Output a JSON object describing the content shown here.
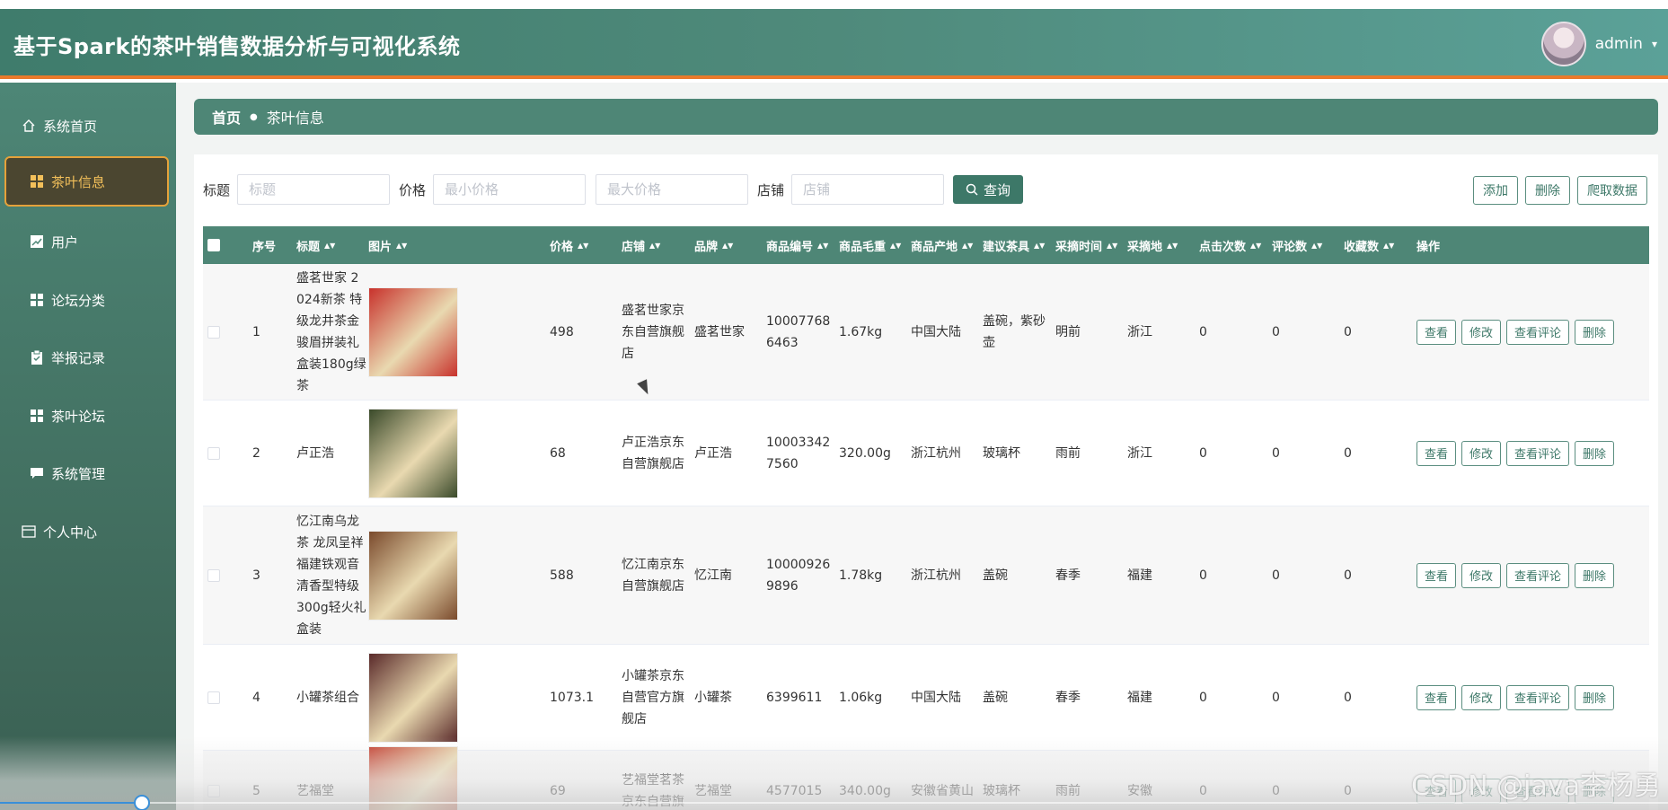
{
  "header": {
    "title": "基于Spark的茶叶销售数据分析与可视化系统",
    "username": "admin",
    "caret": "▾"
  },
  "sidebar": {
    "items": [
      {
        "label": "系统首页",
        "icon": "home-icon"
      },
      {
        "label": "茶叶信息",
        "icon": "grid-icon",
        "active": true
      },
      {
        "label": "用户",
        "icon": "chart-icon"
      },
      {
        "label": "论坛分类",
        "icon": "grid-icon"
      },
      {
        "label": "举报记录",
        "icon": "clipboard-icon"
      },
      {
        "label": "茶叶论坛",
        "icon": "grid-icon"
      },
      {
        "label": "系统管理",
        "icon": "chat-icon"
      },
      {
        "label": "个人中心",
        "icon": "card-icon"
      }
    ]
  },
  "breadcrumb": {
    "home": "首页",
    "current": "茶叶信息"
  },
  "search": {
    "title_label": "标题",
    "title_placeholder": "标题",
    "price_label": "价格",
    "min_price_placeholder": "最小价格",
    "max_price_placeholder": "最大价格",
    "store_label": "店铺",
    "store_placeholder": "店铺",
    "query_button": "查询"
  },
  "toolbar": {
    "add": "添加",
    "delete": "删除",
    "crawl": "爬取数据"
  },
  "table": {
    "headers": {
      "index": "序号",
      "title": "标题",
      "image": "图片",
      "price": "价格",
      "store": "店铺",
      "brand": "品牌",
      "sku": "商品编号",
      "weight": "商品毛重",
      "origin": "商品产地",
      "vessel": "建议茶具",
      "pick_time": "采摘时间",
      "pick_place": "采摘地",
      "clicks": "点击次数",
      "comments": "评论数",
      "favorites": "收藏数",
      "actions": "操作"
    },
    "row_actions": {
      "view": "查看",
      "edit": "修改",
      "view_comments": "查看评论",
      "delete": "删除"
    },
    "rows": [
      {
        "index": "1",
        "title": "盛茗世家 2024新茶 特级龙井茶金骏眉拼装礼盒装180g绿茶",
        "image_color": "#c8322c",
        "price": "498",
        "store": "盛茗世家京东自营旗舰店",
        "brand": "盛茗世家",
        "sku": "100077686463",
        "weight": "1.67kg",
        "origin": "中国大陆",
        "vessel": "盖碗，紫砂壶",
        "pick_time": "明前",
        "pick_place": "浙江",
        "clicks": "0",
        "comments": "0",
        "favorites": "0"
      },
      {
        "index": "2",
        "title": "卢正浩",
        "image_color": "#3a4a2a",
        "price": "68",
        "store": "卢正浩京东自营旗舰店",
        "brand": "卢正浩",
        "sku": "100033427560",
        "weight": "320.00g",
        "origin": "浙江杭州",
        "vessel": "玻璃杯",
        "pick_time": "雨前",
        "pick_place": "浙江",
        "clicks": "0",
        "comments": "0",
        "favorites": "0"
      },
      {
        "index": "3",
        "title": "忆江南乌龙茶 龙凤呈祥福建铁观音清香型特级300g轻火礼盒装",
        "image_color": "#7a4a2c",
        "price": "588",
        "store": "忆江南京东自营旗舰店",
        "brand": "忆江南",
        "sku": "100009269896",
        "weight": "1.78kg",
        "origin": "浙江杭州",
        "vessel": "盖碗",
        "pick_time": "春季",
        "pick_place": "福建",
        "clicks": "0",
        "comments": "0",
        "favorites": "0"
      },
      {
        "index": "4",
        "title": "小罐茶组合",
        "image_color": "#5a2a2a",
        "price": "1073.1",
        "store": "小罐茶京东自营官方旗舰店",
        "brand": "小罐茶",
        "sku": "6399611",
        "weight": "1.06kg",
        "origin": "中国大陆",
        "vessel": "盖碗",
        "pick_time": "春季",
        "pick_place": "福建",
        "clicks": "0",
        "comments": "0",
        "favorites": "0"
      },
      {
        "index": "5",
        "title": "艺福堂",
        "image_color": "#c23a2a",
        "price": "69",
        "store": "艺福堂茗茶京东自营旗",
        "brand": "艺福堂",
        "sku": "4577015",
        "weight": "340.00g",
        "origin": "安徽省黄山",
        "vessel": "玻璃杯",
        "pick_time": "雨前",
        "pick_place": "安徽",
        "clicks": "0",
        "comments": "0",
        "favorites": "0"
      }
    ]
  },
  "watermark": "CSDN @java李杨勇",
  "video_progress": 0.085
}
